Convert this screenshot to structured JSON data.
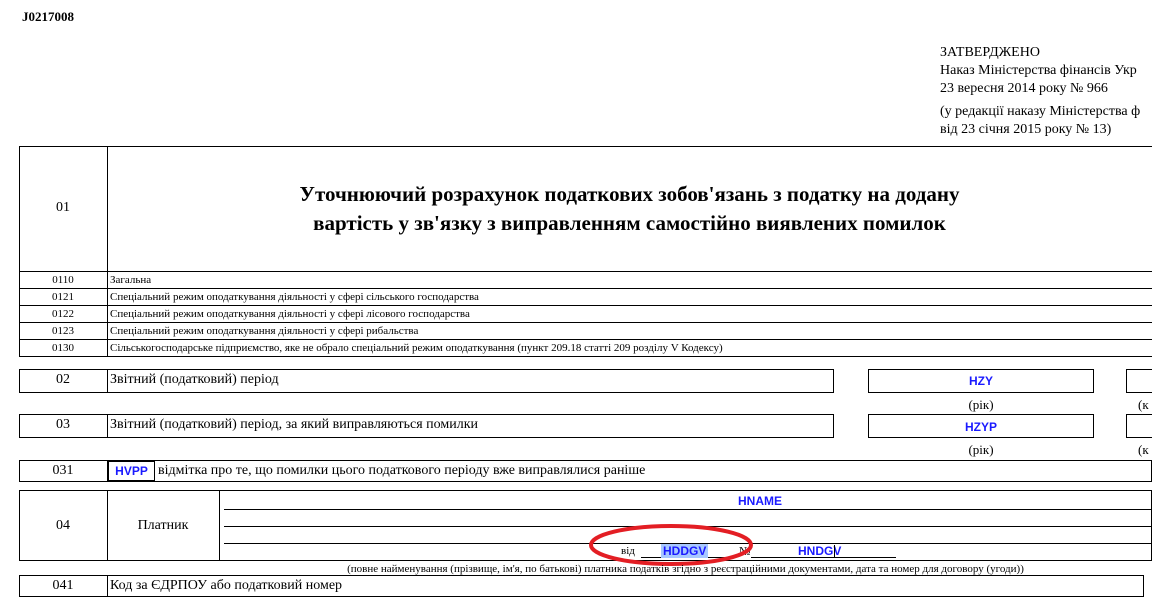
{
  "form_code": "J0217008",
  "approval": {
    "line1": "ЗАТВЕРДЖЕНО",
    "line2": "Наказ Міністерства фінансів Укр",
    "line3": "23 вересня 2014 року  № 966",
    "line4": "(у редакції наказу Міністерства ф",
    "line5": "від 23 січня 2015 року № 13)"
  },
  "section01": {
    "num": "01",
    "title_line1": "Уточнюючий розрахунок податкових зобов'язань з податку на додану",
    "title_line2": "вартість у зв'язку з виправленням самостійно виявлених помилок"
  },
  "types": [
    {
      "code": "0110",
      "text": "Загальна"
    },
    {
      "code": "0121",
      "text": "Спеціальний режим оподаткування діяльності у сфері сільського господарства"
    },
    {
      "code": "0122",
      "text": "Спеціальний режим оподаткування діяльності у сфері лісового господарства"
    },
    {
      "code": "0123",
      "text": "Спеціальний режим оподаткування діяльності у сфері рибальства"
    },
    {
      "code": "0130",
      "text": "Сільськогосподарське підприємство, яке не обрало спеціальний режим оподаткування (пункт 209.18 статті 209 розділу V Кодексу)"
    }
  ],
  "row02": {
    "num": "02",
    "label": "Звітний (податковий) період",
    "field": "HZY",
    "caption": "(рік)",
    "cut_caption": "(к"
  },
  "row03": {
    "num": "03",
    "label": "Звітний (податковий) період, за який виправляються помилки",
    "field": "HZYP",
    "caption": "(рік)",
    "cut_caption": "(к"
  },
  "row031": {
    "num": "031",
    "field": "HVPP",
    "label": "відмітка про те, що помилки цього податкового періоду вже виправлялися раніше"
  },
  "row04": {
    "num": "04",
    "label": "Платник",
    "name_field": "HNAME",
    "date_prefix": "від",
    "date_field": "HDDGV",
    "num_sign": "№",
    "num_field": "HNDGV",
    "caption": "(повне найменування (прізвище, ім'я, по батькові) платника податків згідно з реєстраційними документами, дата та номер для договору (угоди))"
  },
  "row041": {
    "num": "041",
    "label": "Код за ЄДРПОУ або податковий номер"
  },
  "colors": {
    "field_code": "#1a1aff",
    "highlight": "#a8c8ff",
    "circle": "#e31e24"
  }
}
